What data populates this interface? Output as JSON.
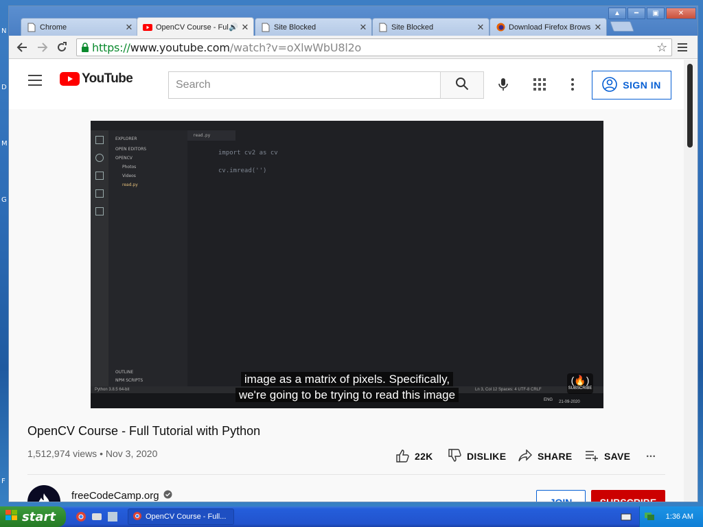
{
  "window": {
    "tabs": [
      {
        "label": "Chrome",
        "favicon": "page-icon",
        "active": false
      },
      {
        "label": "OpenCV Course - Full",
        "favicon": "youtube-icon",
        "active": true,
        "audio": true
      },
      {
        "label": "Site Blocked",
        "favicon": "page-icon",
        "active": false
      },
      {
        "label": "Site Blocked",
        "favicon": "page-icon",
        "active": false
      },
      {
        "label": "Download Firefox Brows",
        "favicon": "firefox-icon",
        "active": false
      }
    ]
  },
  "omnibox": {
    "scheme": "https://",
    "host": "www.youtube.com",
    "path": "/watch?v=oXlwWbU8l2o"
  },
  "youtube": {
    "logo_text": "YouTube",
    "search_placeholder": "Search",
    "sign_in_label": "SIGN IN",
    "video": {
      "caption_line1": "image as a matrix of pixels. Specifically,",
      "caption_line2": "we're going to be trying to read this image",
      "title": "OpenCV Course - Full Tutorial with Python",
      "views": "1,512,974 views",
      "separator": "•",
      "date": "Nov 3, 2020",
      "likes": "22K",
      "dislike_label": "DISLIKE",
      "share_label": "SHARE",
      "save_label": "SAVE",
      "more_label": "..."
    },
    "channel": {
      "name": "freeCodeCamp.org",
      "join_label": "JOIN",
      "subscribe_label": "SUBSCRIBE"
    },
    "vscode": {
      "explorer_label": "EXPLORER",
      "open_editors": "OPEN EDITORS",
      "project": "OPENCV",
      "folders": [
        "Photos",
        "Videos"
      ],
      "file": "read.py",
      "code_lines": [
        "import cv2 as cv",
        "",
        "cv.imread('')"
      ],
      "outline": "OUTLINE",
      "npm": "NPM SCRIPTS",
      "status_left": "Python 3.8.5 64-bit",
      "status_right": "Ln 3, Col 12   Spaces: 4   UTF-8   CRLF",
      "clock": "21-09-2020",
      "lang": "ENG",
      "subscribe_badge": "SUBSCRIBE"
    }
  },
  "taskbar": {
    "start_label": "start",
    "task_label": "OpenCV Course - Full...",
    "clock": "1:36 AM"
  },
  "desktop_letters": [
    "N",
    "D",
    "M",
    "G",
    "F"
  ],
  "colors": {
    "accent": "#065fd4",
    "youtube_red": "#ff0000",
    "subscribe": "#cc0000"
  }
}
